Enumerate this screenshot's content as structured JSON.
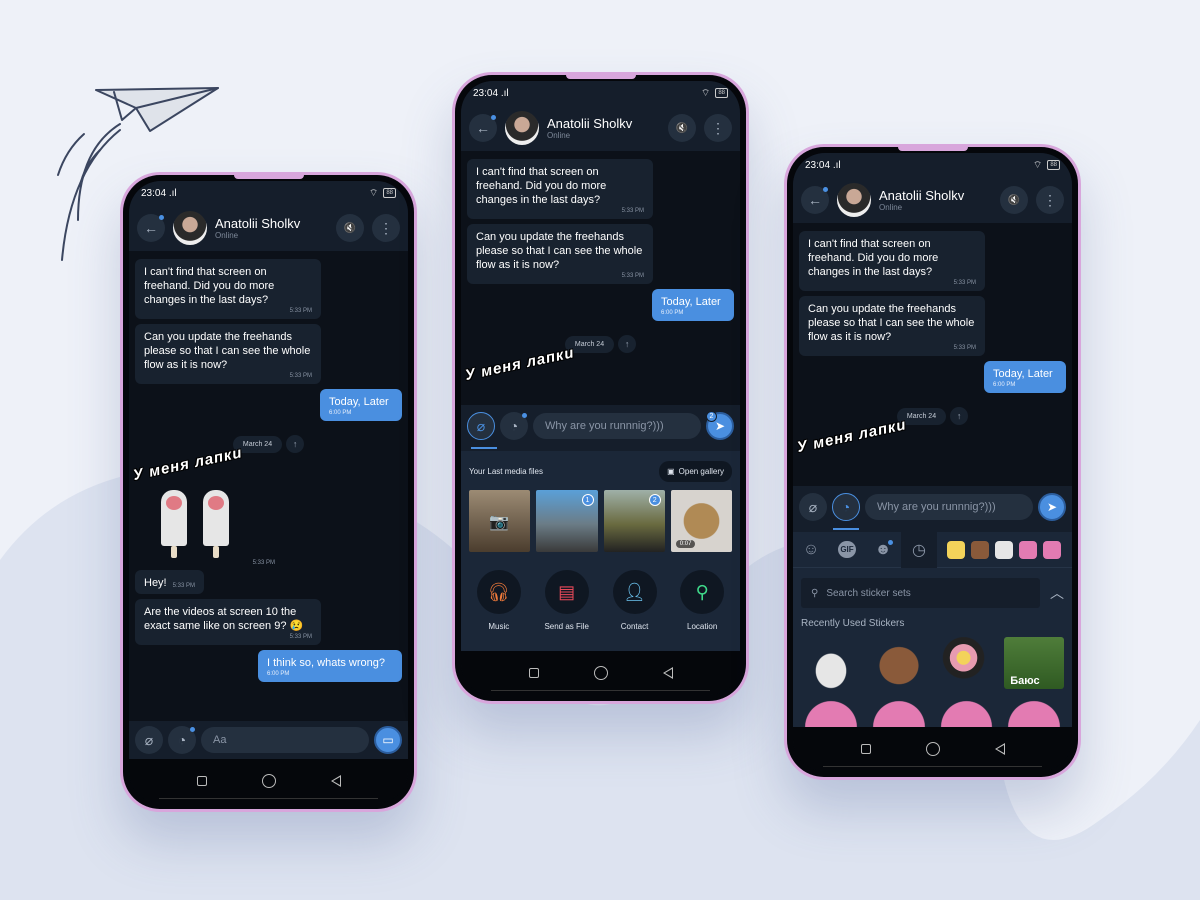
{
  "colors": {
    "accent": "#4a8fe0",
    "background": "#eef1f8",
    "frame": "#d8a6dc",
    "bubble_in": "#18222f",
    "bubble_out": "#4a8fe0"
  },
  "status_bar": {
    "time": "23:04",
    "signal_icon": "signal-icon",
    "wifi_icon": "wifi-icon",
    "battery": "88"
  },
  "contact": {
    "name": "Anatolii Sholkv",
    "status": "Online"
  },
  "header_icons": {
    "back": "←",
    "mute": "🔇",
    "more": "⋮"
  },
  "messages": [
    {
      "direction": "in",
      "text": "I can't find that screen on freehand. Did you do more changes in the last days?",
      "time": "5:33 PM"
    },
    {
      "direction": "in",
      "text": "Can you update the freehands please so that I can see the whole flow as it is now?",
      "time": "5:33 PM"
    },
    {
      "direction": "out",
      "text": "Today, Later",
      "time": "6:00 PM"
    }
  ],
  "date_separator": "March 24",
  "sticker_message": {
    "title": "У меня лапки",
    "time": "5:33 PM"
  },
  "later_messages": [
    {
      "direction": "in",
      "text": "Hey!",
      "time": "5:33 PM"
    },
    {
      "direction": "in",
      "text": "Are the videos at screen 10 the exact same like on screen 9? 😢",
      "time": "5:33 PM"
    },
    {
      "direction": "out",
      "text": "I think so, whats wrong?",
      "time": "6:00 PM"
    }
  ],
  "composer": {
    "placeholder_empty": "Aa",
    "draft_text": "Why are you runnnig?)))",
    "send_badge": "2"
  },
  "media_panel": {
    "title": "Your Last media files",
    "open_gallery": "Open gallery",
    "thumbnails": [
      {
        "type": "camera",
        "badge": ""
      },
      {
        "type": "photo",
        "badge": "1"
      },
      {
        "type": "photo",
        "badge": "2"
      },
      {
        "type": "video",
        "badge": "",
        "duration": "0:07"
      }
    ],
    "attach_options": [
      {
        "label": "Music",
        "icon": "headphones-icon",
        "color": "#f07a3a"
      },
      {
        "label": "Send as File",
        "icon": "file-icon",
        "color": "#e94a5a"
      },
      {
        "label": "Contact",
        "icon": "person-icon",
        "color": "#6cc4f0"
      },
      {
        "label": "Location",
        "icon": "location-pin-icon",
        "color": "#3fd98a"
      }
    ]
  },
  "sticker_panel": {
    "tabs": [
      "emoji",
      "gif",
      "stickers",
      "recent"
    ],
    "search_placeholder": "Search sticker sets",
    "section_title": "Recently Used Stickers",
    "baus_label": "Баюс"
  }
}
